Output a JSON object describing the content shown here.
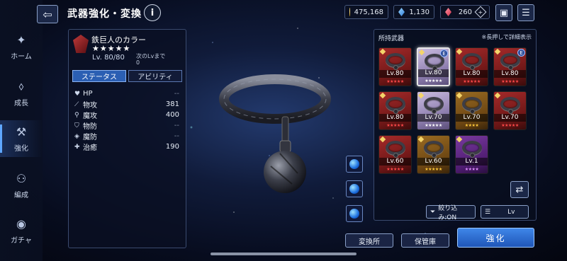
{
  "header": {
    "title": "武器強化・変換",
    "info_icon": "i"
  },
  "currencies": [
    {
      "icon": "gold-coin",
      "value": "475,168"
    },
    {
      "icon": "blue-crystal",
      "value": "1,130"
    },
    {
      "icon": "red-crystal",
      "value": "260"
    }
  ],
  "sidebar": {
    "items": [
      {
        "label": "ホーム",
        "icon": "home-icon"
      },
      {
        "label": "成長",
        "icon": "growth-icon"
      },
      {
        "label": "強化",
        "icon": "enhance-icon",
        "active": true
      },
      {
        "label": "編成",
        "icon": "party-icon"
      },
      {
        "label": "ガチャ",
        "icon": "gacha-icon"
      }
    ]
  },
  "weapon": {
    "name": "鉄巨人のカラー",
    "stars": "★★★★★",
    "level": "Lv. 80/80",
    "next_label": "次のLvまで",
    "next_value": "0"
  },
  "info_tabs": [
    "ステータス",
    "アビリティ"
  ],
  "stats": [
    {
      "label": "HP",
      "value": "--"
    },
    {
      "label": "物攻",
      "value": "381"
    },
    {
      "label": "魔攻",
      "value": "400"
    },
    {
      "label": "物防",
      "value": "--"
    },
    {
      "label": "魔防",
      "value": "--"
    },
    {
      "label": "治癒",
      "value": "190"
    }
  ],
  "inventory": {
    "title": "所持武器",
    "hint": "※長押しで詳細表示",
    "items": [
      {
        "level": "Lv.80",
        "rarity": "red",
        "stars": "★★★★★",
        "equipped": false
      },
      {
        "level": "Lv.80",
        "rarity": "white",
        "stars": "★★★★★",
        "equipped": true,
        "selected": true
      },
      {
        "level": "Lv.80",
        "rarity": "red",
        "stars": "★★★★★",
        "equipped": false
      },
      {
        "level": "Lv.80",
        "rarity": "red",
        "stars": "★★★★★",
        "equipped": true
      },
      {
        "level": "Lv.80",
        "rarity": "red",
        "stars": "★★★★★",
        "equipped": false
      },
      {
        "level": "Lv.70",
        "rarity": "white",
        "stars": "★★★★★",
        "equipped": false
      },
      {
        "level": "Lv.70",
        "rarity": "gold",
        "stars": "★★★★",
        "equipped": false
      },
      {
        "level": "Lv.70",
        "rarity": "red",
        "stars": "★★★★★",
        "equipped": false
      },
      {
        "level": "Lv.60",
        "rarity": "red",
        "stars": "★★★★★",
        "equipped": false
      },
      {
        "level": "Lv.60",
        "rarity": "gold",
        "stars": "★★★★★",
        "equipped": false
      },
      {
        "level": "Lv.1",
        "rarity": "purple",
        "stars": "★★★★",
        "equipped": false
      }
    ],
    "equipped_badge": "E",
    "filter_label": "絞り込み:ON",
    "sort_label": "Lv"
  },
  "buttons": {
    "exchange": "変換所",
    "storage": "保管庫",
    "enhance": "強化"
  },
  "colors": {
    "accent": "#2b5fb3",
    "enhance_button": "#3f86e8"
  }
}
